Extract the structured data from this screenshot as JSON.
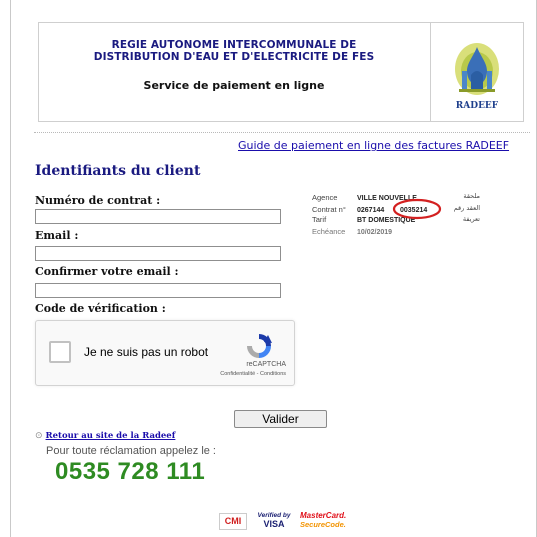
{
  "header": {
    "title_line1": "REGIE AUTONOME INTERCOMMUNALE DE",
    "title_line2": "DISTRIBUTION D'EAU ET D'ELECTRICITE DE FES",
    "subtitle": "Service de paiement en ligne",
    "logo_text": "RADEEF"
  },
  "guide_link": "Guide de paiement en ligne des factures RADEEF",
  "section_title": "Identifiants du client",
  "form": {
    "contract_label": "Numéro de contrat :",
    "contract_value": "",
    "email_label": "Email :",
    "email_value": "",
    "confirm_email_label": "Confirmer votre email :",
    "confirm_email_value": "",
    "verification_label": "Code de vérification :"
  },
  "facture_sample": {
    "rows": [
      {
        "label": "Agence",
        "value": "VILLE NOUVELLE",
        "arabic": "ملحقة"
      },
      {
        "label": "Contrat n°",
        "value_a": "0267144",
        "value_b": "0035214",
        "arabic": "العقد رقم"
      },
      {
        "label": "Tarif",
        "value": "BT DOMESTIQUE",
        "arabic": "تعريفة"
      }
    ],
    "highlight_color": "#d32020"
  },
  "recaptcha": {
    "checkbox_label": "Je ne suis pas un robot",
    "brand": "reCAPTCHA",
    "terms": "Confidentialité - Conditions"
  },
  "submit_label": "Valider",
  "back_link": "Retour au site de la Radeef",
  "claim_text": "Pour toute réclamation appelez le :",
  "phone": "0535 728 111",
  "payment_logos": {
    "cmi": "CMI",
    "visa_line1": "Verified by",
    "visa_line2": "VISA",
    "mastercard_line1": "MasterCard.",
    "mastercard_line2": "SecureCode."
  },
  "colors": {
    "title_blue": "#1a1a80",
    "link_blue": "#1a0dab",
    "phone_green": "#2e8b22"
  }
}
